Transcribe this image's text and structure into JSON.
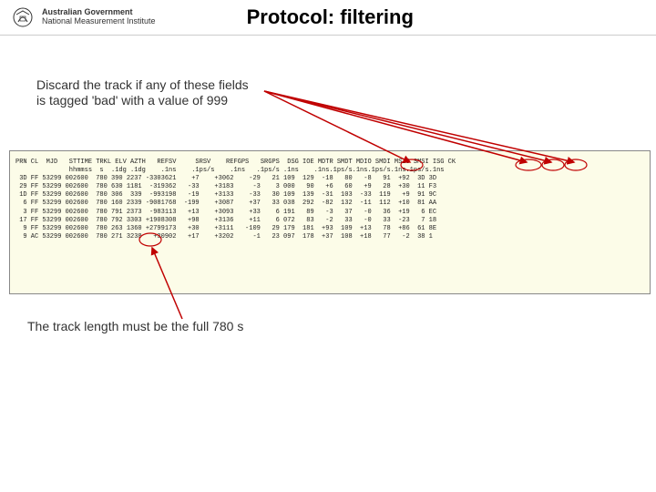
{
  "header": {
    "gov_line1": "Australian Government",
    "gov_line2": "National Measurement Institute",
    "title": "Protocol: filtering"
  },
  "instruction1_line1": "Discard the track if any of these fields",
  "instruction1_line2": "is tagged 'bad' with a value of 999",
  "instruction2": "The track length must be the full 780 s",
  "table": {
    "head1": "PRN CL  MJD   STTIME TRKL ELV AZTH   REFSV     SRSV    REFGPS   SRGPS  DSG IOE MDTR SMDT MDIO SMDI MSIO SMSI ISG CK",
    "head2": "              hhmmss  s  .1dg .1dg    .1ns    .1ps/s    .1ns   .1ps/s .1ns    .1ns.1ps/s.1ns.1ps/s.1ns.1ps/s.1ns",
    "rows": [
      " 3D FF 53299 002600  780 390 2237 -3303621    +7    +3062    -29   21 109  129  -18   80   -8   91  +92  3D 3D",
      " 29 FF 53299 002600  780 630 1181  -319362   -33    +3183     -3    3 000   90   +6   60   +9   28  +30  11 F3",
      " 1D FF 53299 002600  780 306  339  -993198   -19    +3133    -33   30 109  139  -31  103  -33  119   +9  91 9C",
      "  6 FF 53299 002600  780 160 2339 -9081768  -199    +3087    +37   33 038  292  -82  132  -11  112  +10  81 AA",
      "  3 FF 53299 002600  780 791 2373  -983113   +13    +3093    +33    6 191   89   -3   37   -0   36  +19   6 EC",
      " 17 FF 53299 002600  780 792 3303 +1908308   +98    +3136    +11    6 072   83   -2   33   -0   33  -23   7 18",
      "  9 FF 53299 002600  780 263 1360 +2799173   +30    +3111   -109   29 179  181  +93  109  +13   78  +86  61 8E",
      "  9 AC 53299 002600  780 271 3238   +30902   +17    +3202     -1   23 097  178  +37  108  +18   77   -2  38 1"
    ]
  }
}
